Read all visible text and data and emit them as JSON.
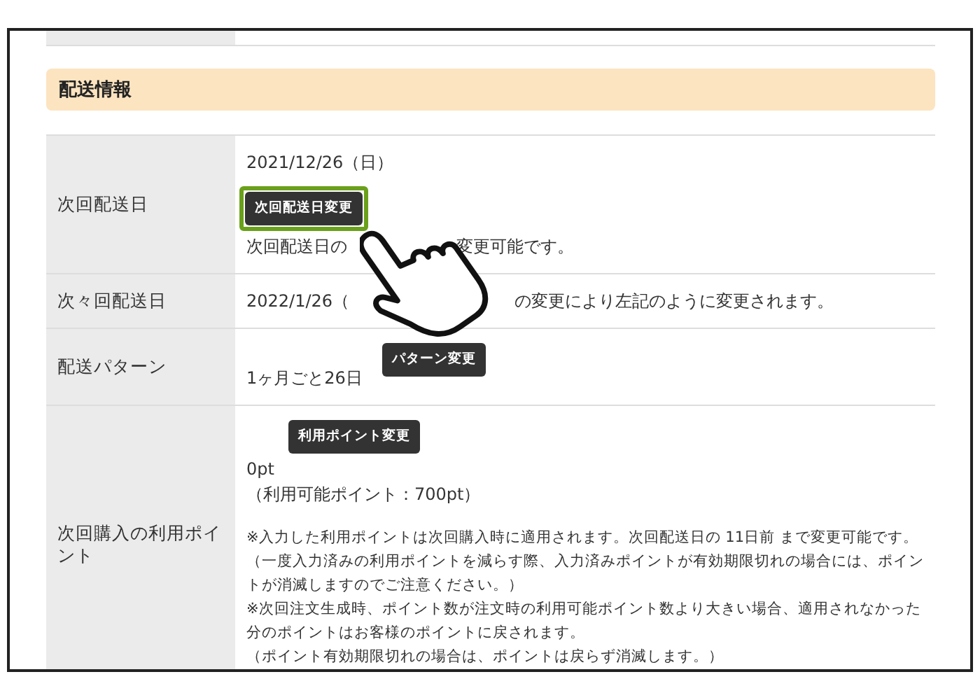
{
  "section": {
    "title": "配送情報"
  },
  "rows": [
    {
      "kind": "next_date",
      "label": "次回配送日",
      "date": "2021/12/26（日）",
      "button": {
        "label": "次回配送日変更",
        "highlighted": true
      },
      "note_before": "次回配送日の",
      "note_after": "変更可能です。"
    },
    {
      "kind": "split_text",
      "label": "次々回配送日",
      "text_before": "2022/1/26（",
      "text_after": "の変更により左記のように変更されます。"
    },
    {
      "kind": "pattern",
      "label": "配送パターン",
      "button": {
        "label": "パターン変更",
        "highlighted": false
      },
      "value": "1ヶ月ごと26日"
    },
    {
      "kind": "points",
      "label": "次回購入の利用ポイント",
      "button": {
        "label": "利用ポイント変更",
        "highlighted": false
      },
      "value": "0pt",
      "available": "（利用可能ポイント：700pt）",
      "notes": [
        "※入力した利用ポイントは次回購入時に適用されます。次回配送日の 11日前 まで変更可能です。",
        "（一度入力済みの利用ポイントを減らす際、入力済みポイントが有効期限切れの場合には、ポイントが消滅しますのでご注意ください。）",
        "※次回注文生成時、ポイント数が注文時の利用可能ポイント数より大きい場合、適用されなかった分のポイントはお客様のポイントに戻されます。",
        "（ポイント有効期限切れの場合は、ポイントは戻らず消滅します。）"
      ]
    }
  ]
}
